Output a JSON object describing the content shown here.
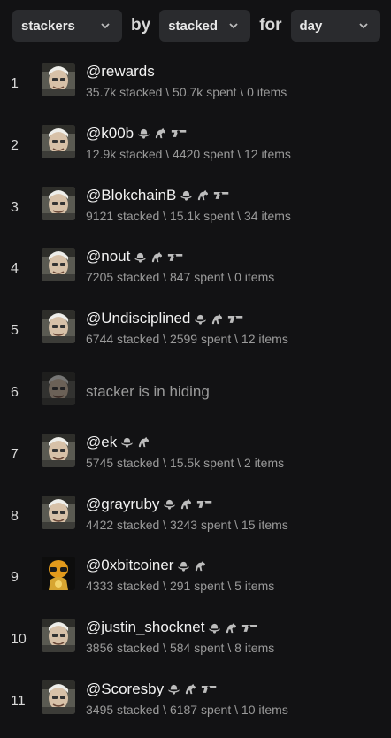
{
  "filters": {
    "type_value": "stackers",
    "by_label": "by",
    "by_value": "stacked",
    "for_label": "for",
    "period_value": "day"
  },
  "rows": [
    {
      "rank": "1",
      "name": "@rewards",
      "stats": "35.7k stacked \\ 50.7k spent \\ 0 items",
      "hidden": false,
      "badges": []
    },
    {
      "rank": "2",
      "name": "@k00b",
      "stats": "12.9k stacked \\ 4420 spent \\ 12 items",
      "hidden": false,
      "badges": [
        "cowboy-hat",
        "horse",
        "gun"
      ]
    },
    {
      "rank": "3",
      "name": "@BlokchainB",
      "stats": "9121 stacked \\ 15.1k spent \\ 34 items",
      "hidden": false,
      "badges": [
        "cowboy-hat",
        "horse",
        "gun"
      ]
    },
    {
      "rank": "4",
      "name": "@nout",
      "stats": "7205 stacked \\ 847 spent \\ 0 items",
      "hidden": false,
      "badges": [
        "cowboy-hat",
        "horse",
        "gun"
      ]
    },
    {
      "rank": "5",
      "name": "@Undisciplined",
      "stats": "6744 stacked \\ 2599 spent \\ 12 items",
      "hidden": false,
      "badges": [
        "cowboy-hat",
        "horse",
        "gun"
      ]
    },
    {
      "rank": "6",
      "name": "",
      "stats": "",
      "hidden": true,
      "hidden_text": "stacker is in hiding",
      "badges": []
    },
    {
      "rank": "7",
      "name": "@ek",
      "stats": "5745 stacked \\ 15.5k spent \\ 2 items",
      "hidden": false,
      "badges": [
        "cowboy-hat",
        "horse"
      ]
    },
    {
      "rank": "8",
      "name": "@grayruby",
      "stats": "4422 stacked \\ 3243 spent \\ 15 items",
      "hidden": false,
      "badges": [
        "cowboy-hat",
        "horse",
        "gun"
      ]
    },
    {
      "rank": "9",
      "name": "@0xbitcoiner",
      "stats": "4333 stacked \\ 291 spent \\ 5 items",
      "hidden": false,
      "badges": [
        "cowboy-hat",
        "horse"
      ],
      "avatar": "gold"
    },
    {
      "rank": "10",
      "name": "@justin_shocknet",
      "stats": "3856 stacked \\ 584 spent \\ 8 items",
      "hidden": false,
      "badges": [
        "cowboy-hat",
        "horse",
        "gun"
      ]
    },
    {
      "rank": "11",
      "name": "@Scoresby",
      "stats": "3495 stacked \\ 6187 spent \\ 10 items",
      "hidden": false,
      "badges": [
        "cowboy-hat",
        "horse",
        "gun"
      ]
    }
  ],
  "colors": {
    "background": "#121214",
    "select_bg": "#2a2b2e",
    "muted_text": "#9a9a9a"
  }
}
